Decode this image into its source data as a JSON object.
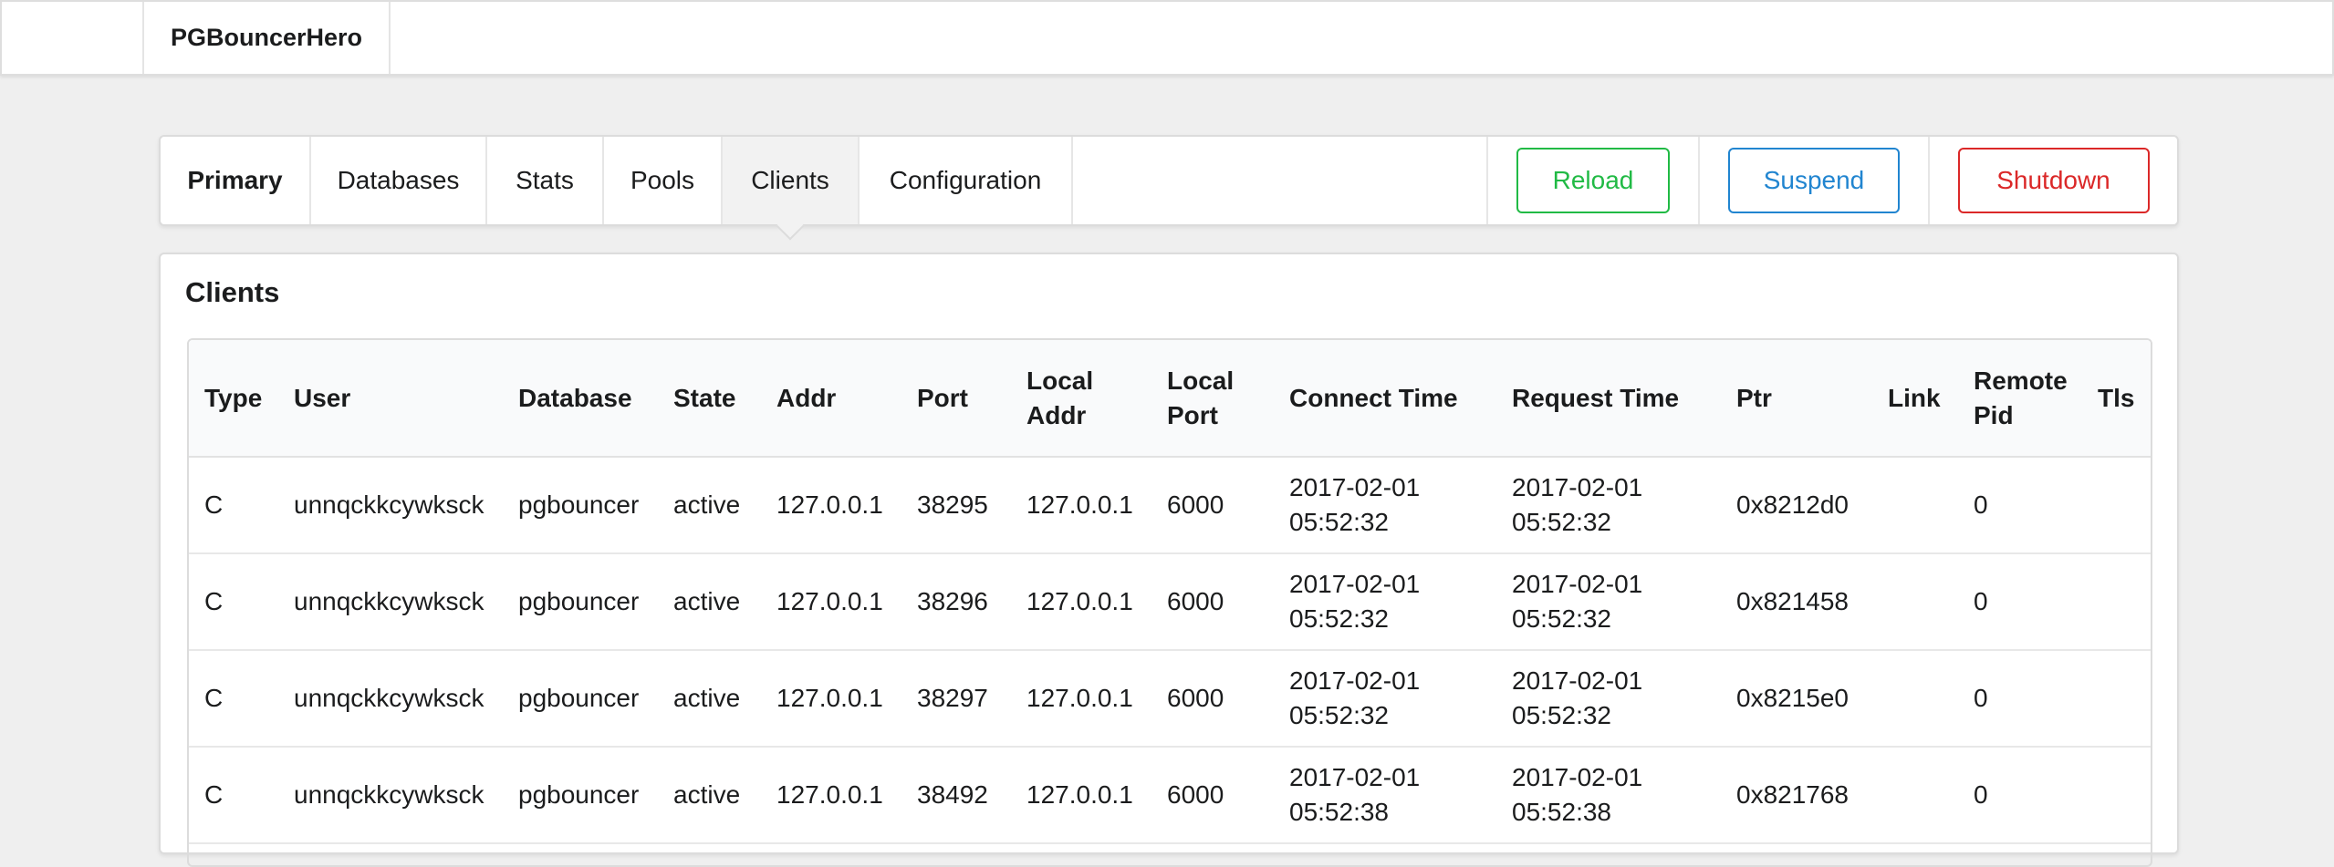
{
  "app": {
    "brand": "PGBouncerHero"
  },
  "menu": {
    "tabs": [
      {
        "label": "Primary"
      },
      {
        "label": "Databases"
      },
      {
        "label": "Stats"
      },
      {
        "label": "Pools"
      },
      {
        "label": "Clients"
      },
      {
        "label": "Configuration"
      }
    ],
    "active_tab": "Clients",
    "buttons": {
      "reload": "Reload",
      "suspend": "Suspend",
      "shutdown": "Shutdown"
    }
  },
  "colors": {
    "reload": "#21ba45",
    "suspend": "#2185d0",
    "shutdown": "#db2828"
  },
  "clients": {
    "title": "Clients",
    "columns": [
      {
        "key": "type",
        "lines": [
          "Type"
        ]
      },
      {
        "key": "user",
        "lines": [
          "User"
        ]
      },
      {
        "key": "database",
        "lines": [
          "Database"
        ]
      },
      {
        "key": "state",
        "lines": [
          "State"
        ]
      },
      {
        "key": "addr",
        "lines": [
          "Addr"
        ]
      },
      {
        "key": "port",
        "lines": [
          "Port"
        ]
      },
      {
        "key": "local_addr",
        "lines": [
          "Local",
          "Addr"
        ]
      },
      {
        "key": "local_port",
        "lines": [
          "Local",
          "Port"
        ]
      },
      {
        "key": "connect_time",
        "lines": [
          "Connect Time"
        ]
      },
      {
        "key": "request_time",
        "lines": [
          "Request Time"
        ]
      },
      {
        "key": "ptr",
        "lines": [
          "Ptr"
        ]
      },
      {
        "key": "link",
        "lines": [
          "Link"
        ]
      },
      {
        "key": "remote_pid",
        "lines": [
          "Remote",
          "Pid"
        ]
      },
      {
        "key": "tls",
        "lines": [
          "Tls"
        ]
      }
    ],
    "rows": [
      {
        "type": "C",
        "user": "unnqckkcywksck",
        "database": "pgbouncer",
        "state": "active",
        "addr": "127.0.0.1",
        "port": "38295",
        "local_addr": "127.0.0.1",
        "local_port": "6000",
        "connect_time": [
          "2017-02-01",
          "05:52:32"
        ],
        "request_time": [
          "2017-02-01",
          "05:52:32"
        ],
        "ptr": "0x8212d0",
        "link": "",
        "remote_pid": "0",
        "tls": ""
      },
      {
        "type": "C",
        "user": "unnqckkcywksck",
        "database": "pgbouncer",
        "state": "active",
        "addr": "127.0.0.1",
        "port": "38296",
        "local_addr": "127.0.0.1",
        "local_port": "6000",
        "connect_time": [
          "2017-02-01",
          "05:52:32"
        ],
        "request_time": [
          "2017-02-01",
          "05:52:32"
        ],
        "ptr": "0x821458",
        "link": "",
        "remote_pid": "0",
        "tls": ""
      },
      {
        "type": "C",
        "user": "unnqckkcywksck",
        "database": "pgbouncer",
        "state": "active",
        "addr": "127.0.0.1",
        "port": "38297",
        "local_addr": "127.0.0.1",
        "local_port": "6000",
        "connect_time": [
          "2017-02-01",
          "05:52:32"
        ],
        "request_time": [
          "2017-02-01",
          "05:52:32"
        ],
        "ptr": "0x8215e0",
        "link": "",
        "remote_pid": "0",
        "tls": ""
      },
      {
        "type": "C",
        "user": "unnqckkcywksck",
        "database": "pgbouncer",
        "state": "active",
        "addr": "127.0.0.1",
        "port": "38492",
        "local_addr": "127.0.0.1",
        "local_port": "6000",
        "connect_time": [
          "2017-02-01",
          "05:52:38"
        ],
        "request_time": [
          "2017-02-01",
          "05:52:38"
        ],
        "ptr": "0x821768",
        "link": "",
        "remote_pid": "0",
        "tls": ""
      }
    ]
  }
}
